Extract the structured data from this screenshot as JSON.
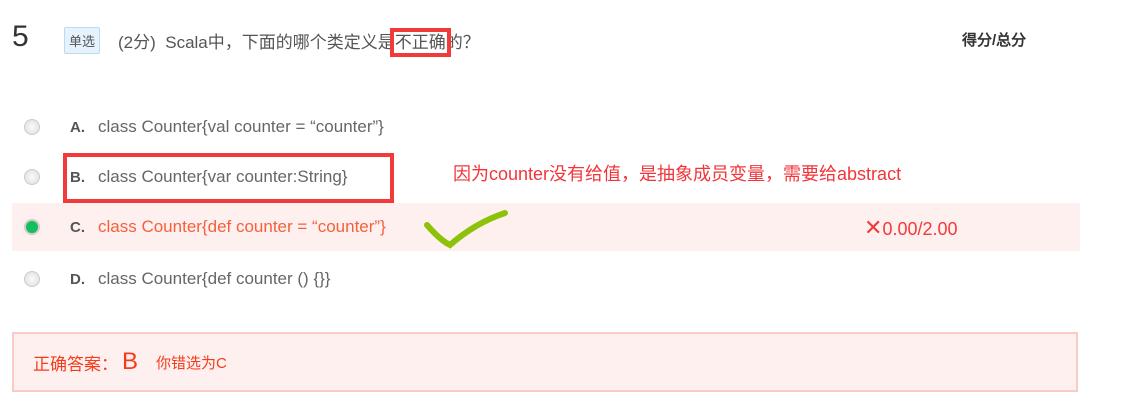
{
  "question": {
    "number": "5",
    "type": "单选",
    "points": "(2分)",
    "text_before": "Scala中，下面的哪个类定义是",
    "text_highlight": "不正确",
    "text_after": "的？",
    "score_header": "得分/总分"
  },
  "options": [
    {
      "letter": "A.",
      "text": "class Counter{val counter = “counter”}",
      "selected": false
    },
    {
      "letter": "B.",
      "text": "class Counter{var counter:String}",
      "selected": false
    },
    {
      "letter": "C.",
      "text": "class Counter{def counter = “counter”}",
      "selected": true
    },
    {
      "letter": "D.",
      "text": "class Counter{def counter () {}}",
      "selected": false
    }
  ],
  "annotation": "因为counter没有给值，是抽象成员变量，需要给abstract",
  "result": {
    "icon": "✕",
    "score": "0.00/2.00"
  },
  "answer": {
    "label": "正确答案：",
    "correct": "B",
    "wrong": "你错选为C"
  },
  "colors": {
    "error": "#f23a3a",
    "check": "#8ec20a",
    "selected_bg": "#fff0f0"
  }
}
